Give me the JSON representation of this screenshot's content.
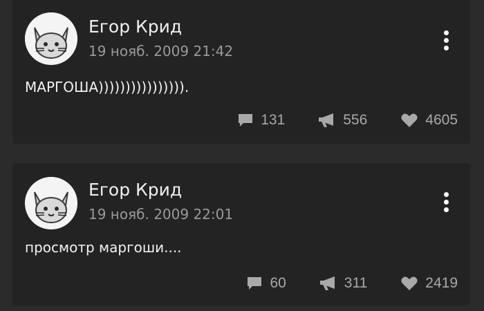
{
  "posts": [
    {
      "author": "Егор Крид",
      "date": "19 нояб. 2009 21:42",
      "text": "МАРГОША)))))))))))))))).",
      "comments": "131",
      "reposts": "556",
      "likes": "4605"
    },
    {
      "author": "Егор Крид",
      "date": "19 нояб. 2009 22:01",
      "text": "просмотр маргоши....",
      "comments": "60",
      "reposts": "311",
      "likes": "2419"
    }
  ],
  "icons": {
    "avatar": "cat-face-icon",
    "menu": "more-vertical-icon",
    "comments": "comment-icon",
    "reposts": "megaphone-icon",
    "likes": "heart-icon"
  },
  "colors": {
    "background": "#2b2b2b",
    "card": "#232323",
    "primary_text": "#f0f0f0",
    "secondary_text": "#9a9a9a",
    "icon": "#a9a9a9"
  }
}
